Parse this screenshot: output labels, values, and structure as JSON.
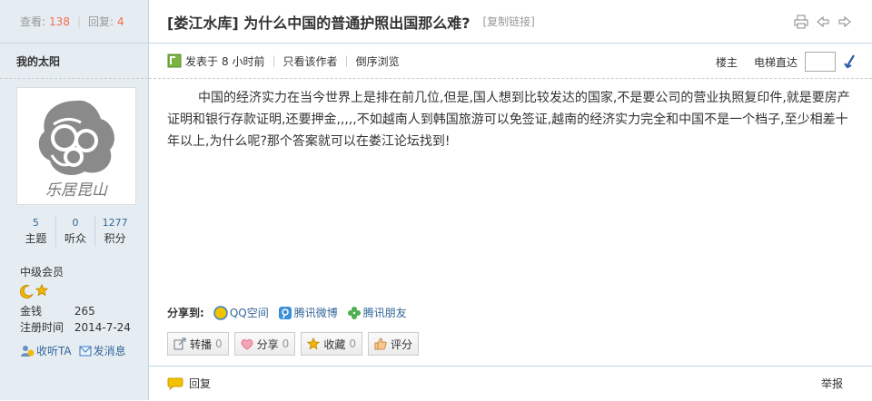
{
  "sidebar": {
    "views_label": "查看:",
    "views_value": "138",
    "replies_label": "回复:",
    "replies_value": "4",
    "author_name": "我的太阳",
    "avatar_text": "乐居昆山",
    "stats": [
      {
        "value": "5",
        "label": "主题"
      },
      {
        "value": "0",
        "label": "听众"
      },
      {
        "value": "1277",
        "label": "积分"
      }
    ],
    "rank": "中级会员",
    "info": [
      {
        "key": "金钱",
        "value": "265"
      },
      {
        "key": "注册时间",
        "value": "2014-7-24"
      }
    ],
    "actions": [
      {
        "label": "收听TA"
      },
      {
        "label": "发消息"
      }
    ]
  },
  "post": {
    "title": "[娄江水库] 为什么中国的普通护照出国那么难?",
    "copy_link": "[复制链接]",
    "posted_prefix": "发表于",
    "posted_time": "8 小时前",
    "only_author": "只看该作者",
    "reverse_view": "倒序浏览",
    "floor": "楼主",
    "jump_label": "电梯直达",
    "content": "中国的经济实力在当今世界上是排在前几位,但是,国人想到比较发达的国家,不是要公司的营业执照复印件,就是要房产证明和银行存款证明,还要押金,,,,,不如越南人到韩国旅游可以免签证,越南的经济实力完全和中国不是一个档子,至少相差十年以上,为什么呢?那个答案就可以在娄江论坛找到!",
    "share_label": "分享到:",
    "share_links": [
      "QQ空间",
      "腾讯微博",
      "腾讯朋友"
    ],
    "buttons": [
      {
        "label": "转播",
        "count": "0"
      },
      {
        "label": "分享",
        "count": "0"
      },
      {
        "label": "收藏",
        "count": "0"
      },
      {
        "label": "评分",
        "count": ""
      }
    ],
    "reply": "回复",
    "report": "举报"
  },
  "colors": {
    "accent": "#336699",
    "num": "#f26c4f",
    "sidebar_bg": "#e5edf2",
    "border": "#c2d5e3"
  }
}
